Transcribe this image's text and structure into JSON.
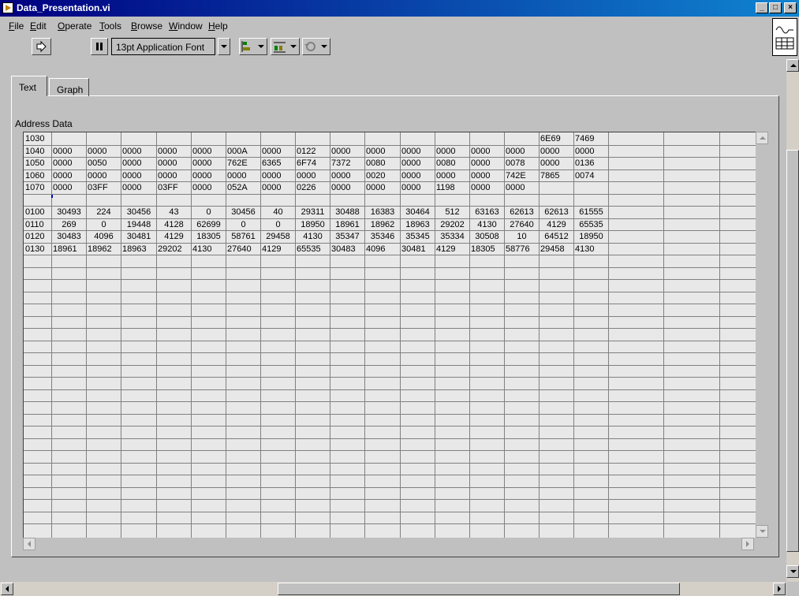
{
  "window": {
    "title": "Data_Presentation.vi"
  },
  "menu": [
    {
      "ul": "F",
      "rest": "ile"
    },
    {
      "ul": "E",
      "rest": "dit"
    },
    {
      "ul": "O",
      "rest": "perate"
    },
    {
      "ul": "T",
      "rest": "ools"
    },
    {
      "ul": "B",
      "rest": "rowse"
    },
    {
      "ul": "W",
      "rest": "indow"
    },
    {
      "ul": "H",
      "rest": "elp"
    }
  ],
  "toolbar": {
    "font_label": "13pt Application Font"
  },
  "tabs": {
    "text": "Text",
    "graph": "Graph"
  },
  "table": {
    "header": "Address Data",
    "rows": [
      {
        "addr": "1030",
        "cells": [
          "",
          "",
          "",
          "",
          "",
          "",
          "",
          "",
          "",
          "",
          "",
          "",
          "",
          "",
          "6E69",
          "7469"
        ]
      },
      {
        "addr": "1040",
        "cells": [
          "0000",
          "0000",
          "0000",
          "0000",
          "0000",
          "000A",
          "0000",
          "0122",
          "0000",
          "0000",
          "0000",
          "0000",
          "0000",
          "0000",
          "0000",
          "0000"
        ]
      },
      {
        "addr": "1050",
        "cells": [
          "0000",
          "0050",
          "0000",
          "0000",
          "0000",
          "762E",
          "6365",
          "6F74",
          "7372",
          "0080",
          "0000",
          "0080",
          "0000",
          "0078",
          "0000",
          "0136"
        ]
      },
      {
        "addr": "1060",
        "cells": [
          "0000",
          "0000",
          "0000",
          "0000",
          "0000",
          "0000",
          "0000",
          "0000",
          "0000",
          "0020",
          "0000",
          "0000",
          "0000",
          "742E",
          "7865",
          "0074"
        ]
      },
      {
        "addr": "1070",
        "cells": [
          "0000",
          "03FF",
          "0000",
          "03FF",
          "0000",
          "052A",
          "0000",
          "0226",
          "0000",
          "0000",
          "0000",
          "1198",
          "0000",
          "0000",
          "",
          ""
        ]
      },
      {
        "addr": "",
        "cells": [
          "",
          "",
          "",
          "",
          "",
          "",
          "",
          "",
          "",
          "",
          "",
          "",
          "",
          "",
          "",
          ""
        ]
      },
      {
        "addr": "0100",
        "cells": [
          "30493",
          "224",
          "30456",
          "43",
          "0",
          "30456",
          "40",
          "29311",
          "30488",
          "16383",
          "30464",
          "512",
          "63163",
          "62613",
          "62613",
          "61555"
        ]
      },
      {
        "addr": "0110",
        "cells": [
          "269",
          "0",
          "19448",
          "4128",
          "62699",
          "0",
          "0",
          "18950",
          "18961",
          "18962",
          "18963",
          "29202",
          "4130",
          "27640",
          "4129",
          "65535"
        ]
      },
      {
        "addr": "0120",
        "cells": [
          "30483",
          "4096",
          "30481",
          "4129",
          "18305",
          "58761",
          "29458",
          "4130",
          "35347",
          "35346",
          "35345",
          "35334",
          "30508",
          "10",
          "64512",
          "18950"
        ]
      },
      {
        "addr": "0130",
        "cells": [
          "18961",
          "18962",
          "18963",
          "29202",
          "4130",
          "27640",
          "4129",
          "65535",
          "30483",
          "4096",
          "30481",
          "4129",
          "18305",
          "58776",
          "29458",
          "4130"
        ]
      }
    ],
    "center_rows": [
      6,
      7,
      8
    ]
  }
}
